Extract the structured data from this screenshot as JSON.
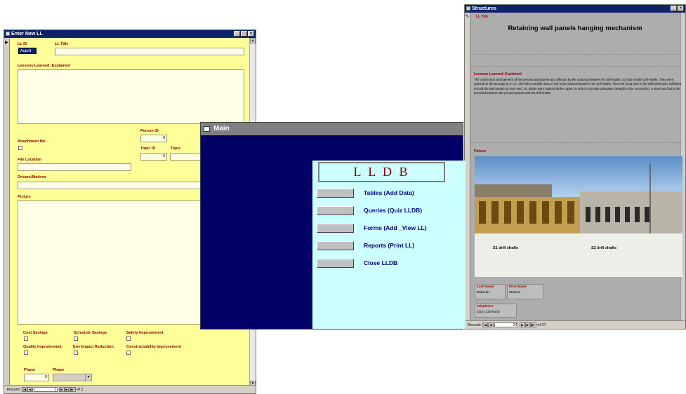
{
  "enter_window": {
    "title": "Enter New LL",
    "fields": {
      "ll_id_label": "LL ID",
      "ll_id_value": "AutoN",
      "ll_title_label": "LL Title",
      "lessons_label": "Lessons Learned: Explained",
      "person_id_label": "Person ID",
      "person_id_value": "0",
      "attachment_label": "Attachment file",
      "topic_id_label": "Topic ID",
      "topic_id_value": "0",
      "topic_label": "Topic",
      "file_location_label": "File Location",
      "drivers_label": "Drivers/Motives",
      "picture_label": "Picture",
      "cost_savings_label": "Cost Savings",
      "schedule_savings_label": "Schedule Savings",
      "safety_label": "Safety Improvement",
      "quality_label": "Quality Improvement",
      "env_label": "Env Impact Reduction",
      "constructability_label": "Constructability Improvement",
      "phase_label_1": "Phase",
      "phase_value_1": "0",
      "phase_label_2": "Phase"
    },
    "navbar": {
      "label": "Record:",
      "current": "1",
      "of": "of 1"
    }
  },
  "main_window": {
    "title": "Main",
    "heading": "L L D B",
    "menu": [
      {
        "label": "Tables (Add Data)"
      },
      {
        "label": "Queries (Quiz LLDB)"
      },
      {
        "label": "Forms (Add _View LL)"
      },
      {
        "label": "Reports (Print LL)"
      },
      {
        "label": "Close LLDB"
      }
    ]
  },
  "struct_window": {
    "title": "Structures",
    "ll_title_label": "LL Title",
    "ll_title_value": "Retaining wall panels hanging mechanism",
    "lessons_label": "Lessons Learned: Explained",
    "lessons_text": "The connection arrangement of the precast wall panels was affected by the spacing between the drill-shafts. S2 had smaller drill-shafts. They were spaced on the average at 4' c/c. This left a smaller area of soil to be retained between the drill-shafts. Thus the hoop bars in the drill-shaft were sufficient to hold the wall panels on their own. S1 shafts were spaced further apart. In order to provide adequate strength to the connection, a steel mat had to be provided between the precast panels and the drill-shafts.",
    "picture_label": "Picture",
    "photo_caption_left": "S1 drill shafts",
    "photo_caption_right": "S2 drill shafts",
    "last_name_label": "Last Name",
    "last_name_value": "Bakarah",
    "first_name_label": "First Name",
    "first_name_value": "Mahran",
    "telephone_label": "Telephone",
    "telephone_value": "(214) 330-8240",
    "navbar": {
      "label": "Record:",
      "current": "24",
      "of": "of 27"
    }
  },
  "colors": {
    "title_bar": "#0a246a",
    "form_yellow": "#ffff99",
    "label_red": "#8b0000",
    "main_navy": "#000066",
    "main_panel": "#ccffff"
  }
}
